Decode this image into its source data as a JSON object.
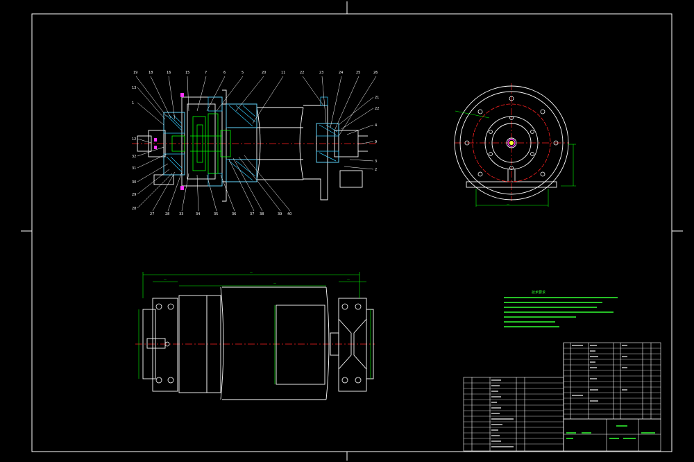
{
  "drawing": {
    "title": "技术要求",
    "notes": [
      "1 ",
      "2 ",
      "3 ",
      "4 ",
      "5 ",
      "6 ",
      "7 "
    ],
    "callouts_top": [
      "19",
      "18",
      "16",
      "15",
      "7",
      "6",
      "5",
      "20",
      "11",
      "22",
      "23",
      "24",
      "25",
      "26"
    ],
    "callouts_left": [
      "13",
      "1",
      "12",
      "32",
      "31",
      "30",
      "29",
      "28"
    ],
    "callouts_bottom": [
      "27",
      "28",
      "33",
      "34",
      "35",
      "36",
      "37",
      "38",
      "39",
      "40"
    ],
    "callouts_right": [
      "21",
      "22",
      "4",
      "9",
      "3",
      "2"
    ],
    "colors": {
      "background": "#000000",
      "line": "#ffffff",
      "dim": "#00ff00",
      "center": "#ff2020",
      "hatch": "#33ccff",
      "part": "#ff33ff",
      "note": "#33ff33"
    }
  }
}
